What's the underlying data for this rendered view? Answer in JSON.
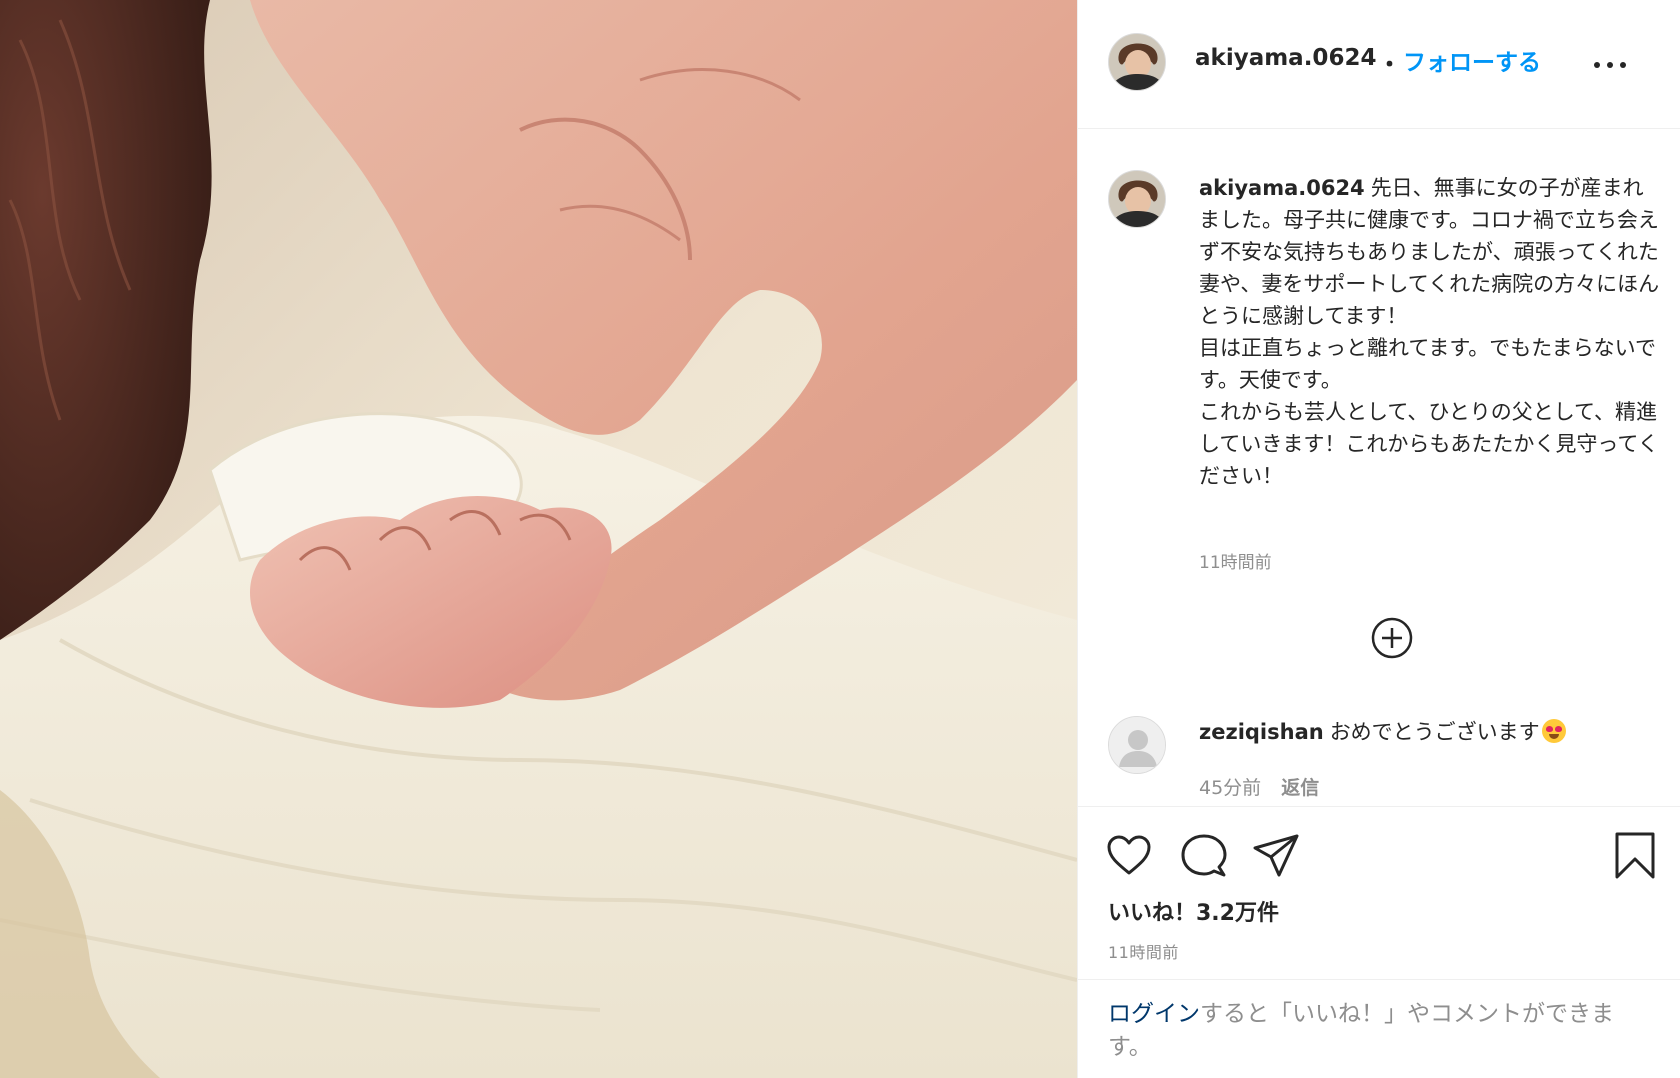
{
  "post": {
    "username": "akiyama.0624",
    "separator": "・",
    "follow_label": "フォローする",
    "more_icon": "more-options-icon"
  },
  "caption": {
    "username": "akiyama.0624",
    "text": "先日、無事に女の子が産まれました。母子共に健康です。コロナ禍で立ち会えず不安な気持ちもありましたが、頑張ってくれた妻や、妻をサポートしてくれた病院の方々にほんとうに感謝してます！\n目は正直ちょっと離れてます。でもたまらないです。天使です。\nこれからも芸人として、ひとりの父として、精進していきます！これからもあたたかく見守ってください！",
    "time": "11時間前"
  },
  "load_more_icon": "add-circle-icon",
  "comment": {
    "username": "zeziqishan",
    "text": "おめでとうございます",
    "emoji": "heart-eyes-emoji",
    "time": "45分前",
    "reply_label": "返信"
  },
  "actions": {
    "like_icon": "heart-icon",
    "comment_icon": "comment-icon",
    "share_icon": "share-icon",
    "save_icon": "bookmark-icon",
    "likes_text": "いいね！3.2万件",
    "time": "11時間前"
  },
  "login_prompt": {
    "link_label": "ログイン",
    "rest": "すると「いいね！」やコメントができます。"
  },
  "colors": {
    "link_blue": "#0095f6",
    "text": "#262626",
    "muted": "#8e8e8e",
    "dark_link": "#00376b"
  }
}
